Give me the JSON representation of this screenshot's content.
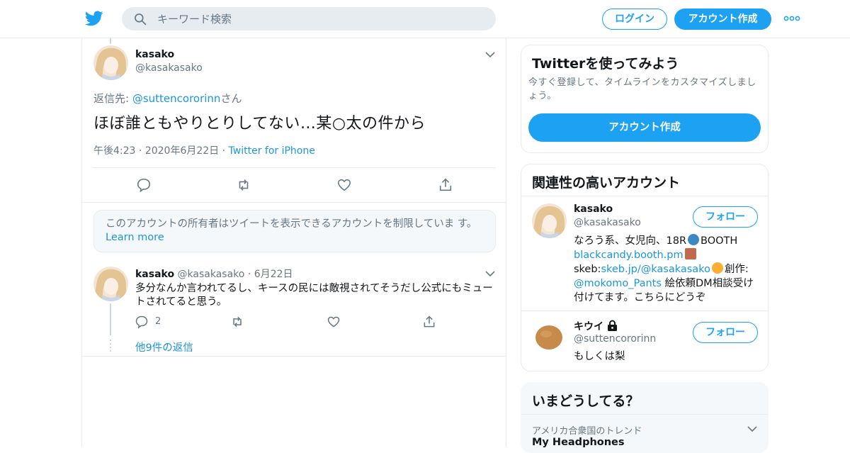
{
  "header": {
    "search_placeholder": "キーワード検索",
    "login_label": "ログイン",
    "signup_label": "アカウント作成"
  },
  "main_tweet": {
    "name": "kasako",
    "handle": "@kasakasako",
    "reply_prefix": "返信先: ",
    "reply_to": "@suttencororinn",
    "reply_suffix": "さん",
    "text": "ほぼ誰ともやりとりしてない…某○太の件から",
    "time": "午後4:23",
    "date": "2020年6月22日",
    "source": "Twitter for iPhone"
  },
  "notice": {
    "text": "このアカウントの所有者はツイートを表示できるアカウントを制限していま す。",
    "link": "Learn more"
  },
  "reply": {
    "name": "kasako",
    "handle": "@kasakasako",
    "date": "6月22日",
    "text": "多分なんか言われてるし、キースの民には敵視されてそうだし公式にもミュートされてると思う。",
    "reply_count": "2",
    "more_replies": "他9件の返信"
  },
  "sidebar": {
    "signup_card": {
      "title": "Twitterを使ってみよう",
      "desc": "今すぐ登録して、タイムラインをカスタマイズしましょう。",
      "button": "アカウント作成"
    },
    "related": {
      "title": "関連性の高いアカウント",
      "follow_label": "フォロー",
      "accounts": [
        {
          "name": "kasako",
          "handle": "@kasakasako",
          "bio_line1": "なろう系、女児向、18R",
          "bio_booth": "BOOTH",
          "bio_link1": "blackcandy.booth.pm",
          "bio_skeb_prefix": "skeb:",
          "bio_link2": "skeb.jp/@kasakasako",
          "bio_create": "創作:",
          "bio_link3": "@mokomo_Pants",
          "bio_rest": " 絵依頼DM相談受け付けてます。こちらにどうぞ"
        },
        {
          "name": "キウイ",
          "handle": "@suttencororinn",
          "bio": "もしくは梨"
        }
      ]
    },
    "trends": {
      "title": "いまどうしてる？",
      "location": "アメリカ合衆国のトレンド",
      "first": "My Headphones"
    }
  }
}
